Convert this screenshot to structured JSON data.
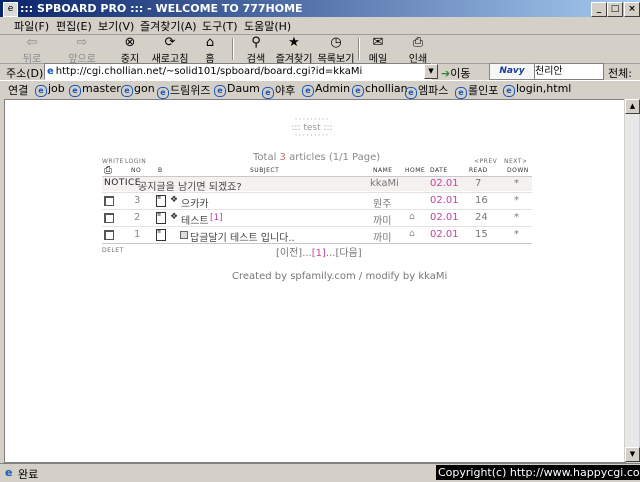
{
  "window": {
    "title": "::: SPBOARD PRO ::: - WELCOME TO 777HOME",
    "btn_minimize": "_",
    "btn_maximize": "□",
    "btn_close": "×"
  },
  "menu": [
    "파일(F)",
    "편집(E)",
    "보기(V)",
    "즐겨찾기(A)",
    "도구(T)",
    "도움말(H)"
  ],
  "toolbar": {
    "back": "뒤로",
    "forward": "앞으로",
    "stop": "중지",
    "refresh": "새로고침",
    "home": "홈",
    "search": "검색",
    "favorites": "즐겨찾기",
    "history": "목록보기",
    "mail": "메일",
    "print": "인쇄"
  },
  "address": {
    "label": "주소(D)",
    "url": "http://cgi.chollian.net/~solid101/spboard/board.cgi?id=kkaMi",
    "go": "이동",
    "navy_logo": "Navy",
    "navy_input": "천리안",
    "navy_all": "전체:"
  },
  "links": {
    "label": "연결",
    "items": [
      "job",
      "master",
      "gon",
      "드림위즈",
      "Daum",
      "야후",
      "Admin",
      "chollian",
      "엠파스",
      "롤인포",
      "login,html"
    ]
  },
  "board": {
    "head_title": "::: test :::",
    "summary_pre": "Total",
    "summary_count": "3",
    "summary_post": "articles (1/1 Page)",
    "write": "WRITE",
    "login": "LOGIN",
    "prev": "<PREV",
    "next": "NEXT>",
    "delete": "DELET",
    "headers": {
      "no": "NO",
      "file": "B",
      "subject": "SUBJECT",
      "name": "NAME",
      "home": "HOME",
      "date": "DATE",
      "read": "READ",
      "down": "DOWN"
    },
    "notice": {
      "label": "NOTICE",
      "subject": "공지글을 남기면 되겠죠?",
      "name": "kkaMi",
      "date": "02.01",
      "read": "7",
      "down": "*"
    },
    "rows": [
      {
        "no": "3",
        "subject": "으카카",
        "comments": "",
        "name": "원주",
        "home": false,
        "date": "02.01",
        "read": "16",
        "down": "*"
      },
      {
        "no": "2",
        "subject": "테스트",
        "comments": "[1]",
        "name": "까미",
        "home": true,
        "date": "02.01",
        "read": "24",
        "down": "*"
      },
      {
        "no": "1",
        "subject": "답글달기 테스트 입니다..",
        "comments": "",
        "name": "까미",
        "home": true,
        "date": "02.01",
        "read": "15",
        "down": "*"
      }
    ],
    "pager_prev": "[이전]...",
    "pager_current": "[1]",
    "pager_next": "...[다음]",
    "credit": "Created by spfamily.com / modify by kkaMi"
  },
  "status": {
    "text": "완료",
    "copyright": "Copyright(c) http://www.happycgi.com"
  }
}
